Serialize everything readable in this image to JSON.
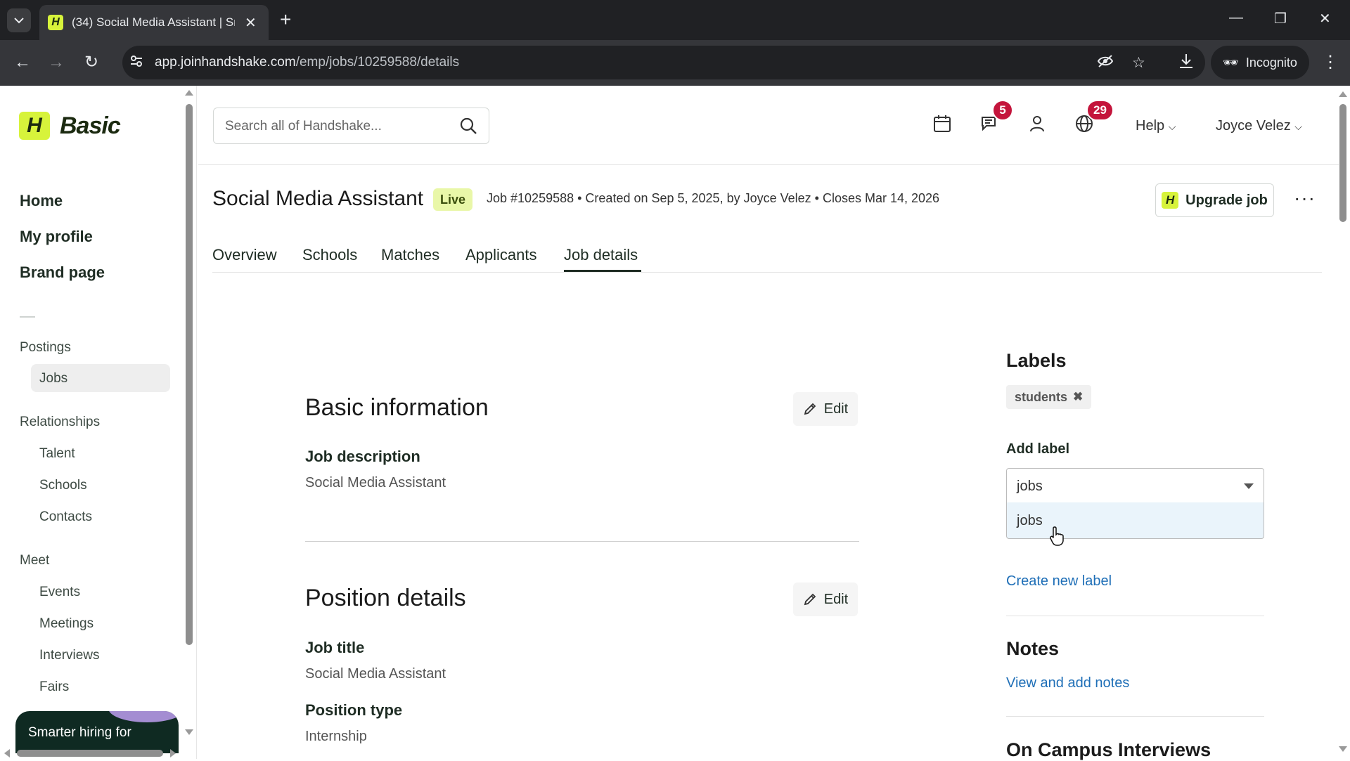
{
  "browser": {
    "tab_title": "(34) Social Media Assistant | Sm",
    "url_host": "app.joinhandshake.com",
    "url_path": "/emp/jobs/10259588/details",
    "incognito_label": "Incognito"
  },
  "sidebar": {
    "logo_text": "Basic",
    "main_items": [
      {
        "label": "Home"
      },
      {
        "label": "My profile"
      },
      {
        "label": "Brand page"
      }
    ],
    "groups": {
      "postings": {
        "label": "Postings",
        "items": [
          "Jobs"
        ]
      },
      "relationships": {
        "label": "Relationships",
        "items": [
          "Talent",
          "Schools",
          "Contacts"
        ]
      },
      "meet": {
        "label": "Meet",
        "items": [
          "Events",
          "Meetings",
          "Interviews",
          "Fairs"
        ]
      }
    },
    "promo_text": "Smarter hiring for"
  },
  "header": {
    "search_placeholder": "Search all of Handshake...",
    "messages_badge": "5",
    "notifications_badge": "29",
    "help_label": "Help",
    "user_name": "Joyce Velez"
  },
  "job": {
    "title": "Social Media Assistant",
    "status": "Live",
    "meta": "Job #10259588 • Created on Sep 5, 2025, by Joyce Velez • Closes Mar 14, 2026",
    "upgrade_label": "Upgrade job",
    "tabs": [
      "Overview",
      "Schools",
      "Matches",
      "Applicants",
      "Job details"
    ],
    "active_tab": "Job details"
  },
  "content": {
    "basic_info": {
      "title": "Basic information",
      "edit_label": "Edit",
      "job_description_label": "Job description",
      "job_description_value": "Social Media Assistant"
    },
    "position_details": {
      "title": "Position details",
      "edit_label": "Edit",
      "job_title_label": "Job title",
      "job_title_value": "Social Media Assistant",
      "position_type_label": "Position type",
      "position_type_value": "Internship"
    }
  },
  "right_panel": {
    "labels_title": "Labels",
    "label_chips": [
      "students"
    ],
    "add_label_title": "Add label",
    "select_value": "jobs",
    "dropdown_option": "jobs",
    "create_new_label": "Create new label",
    "notes_title": "Notes",
    "notes_link": "View and add notes",
    "on_campus_title": "On Campus Interviews"
  },
  "colors": {
    "brand_accent": "#d7f33b",
    "badge_red": "#c4153c",
    "link_blue": "#1f6fb7",
    "live_bg": "#e9f7a8"
  }
}
